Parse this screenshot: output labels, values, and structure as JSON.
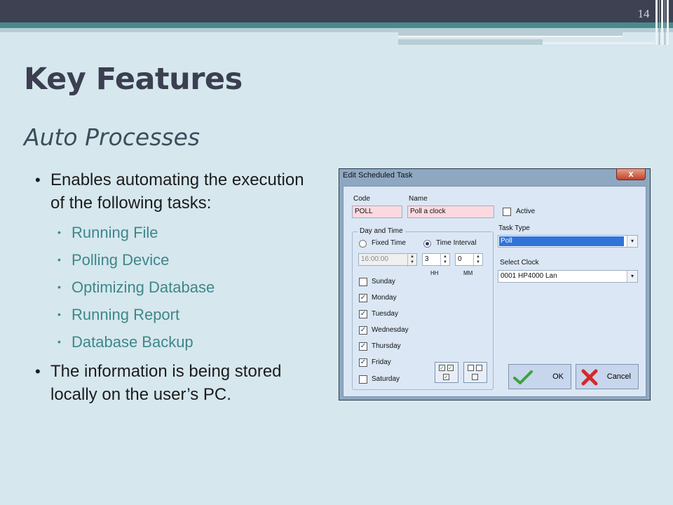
{
  "slide": {
    "number": "14",
    "title": "Key Features",
    "subtitle": "Auto Processes",
    "bullet1": "Enables automating the execution of the following tasks:",
    "subitems": [
      "Running File",
      "Polling Device",
      "Optimizing Database",
      "Running Report",
      "Database Backup"
    ],
    "bullet2": "The information is being stored locally on the user’s PC."
  },
  "dialog": {
    "title": "Edit Scheduled Task",
    "close_label": "x",
    "code_label": "Code",
    "code_value": "POLL",
    "name_label": "Name",
    "name_value": "Poll a clock",
    "active_label": "Active",
    "group_title": "Day and Time",
    "fixed_time_label": "Fixed Time",
    "time_interval_label": "Time Interval",
    "fixed_time_value": "16:00:00",
    "hh_value": "3",
    "mm_value": "0",
    "hh_label": "HH",
    "mm_label": "MM",
    "days": [
      {
        "label": "Sunday",
        "checked": false
      },
      {
        "label": "Monday",
        "checked": true
      },
      {
        "label": "Tuesday",
        "checked": true
      },
      {
        "label": "Wednesday",
        "checked": true
      },
      {
        "label": "Thursday",
        "checked": true
      },
      {
        "label": "Friday",
        "checked": true
      },
      {
        "label": "Saturday",
        "checked": false
      }
    ],
    "task_type_label": "Task Type",
    "task_type_value": "Poll",
    "select_clock_label": "Select Clock",
    "clock_value": "0001   HP4000 Lan",
    "ok_label": "OK",
    "cancel_label": "Cancel",
    "check_mark": "✓"
  }
}
